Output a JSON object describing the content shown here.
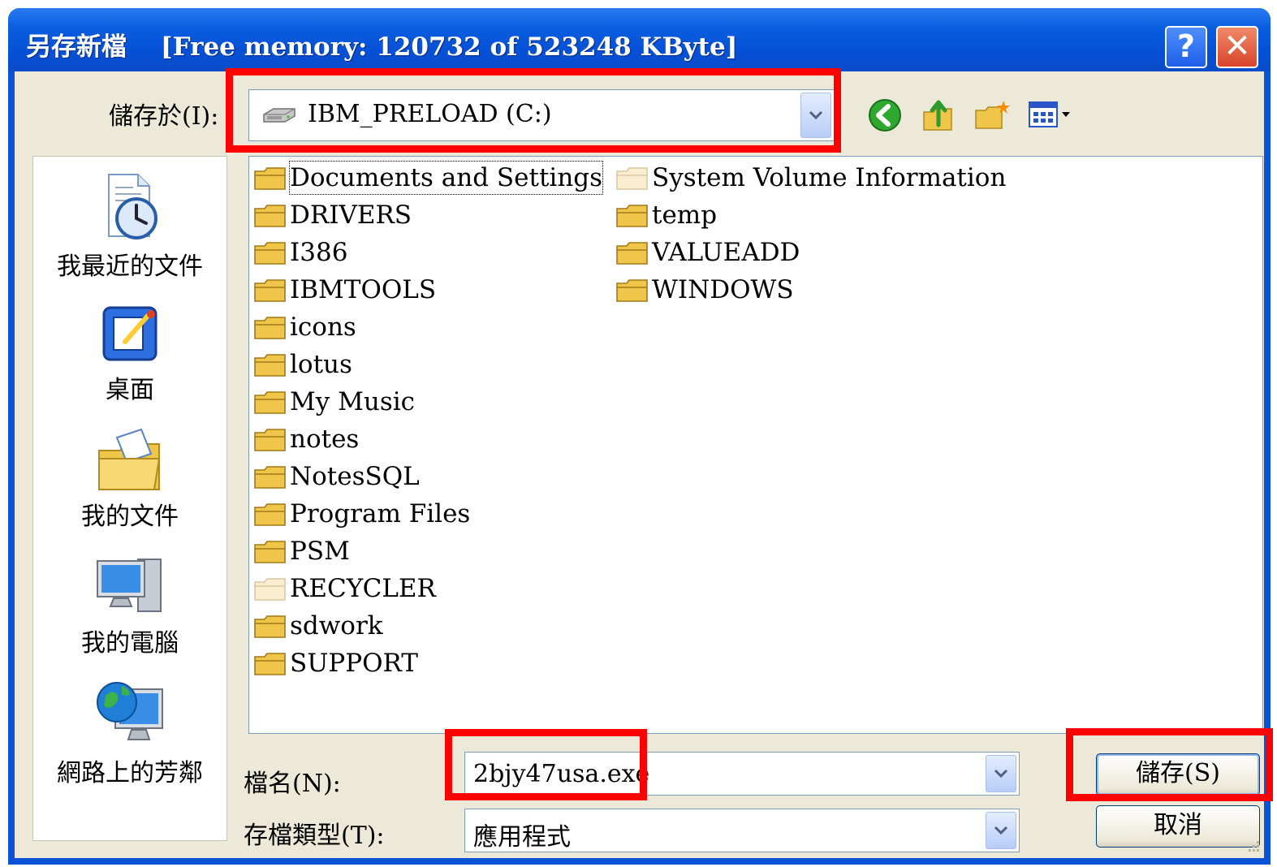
{
  "window": {
    "title": "另存新檔",
    "memory_info": "[Free memory: 120732 of 523248 KByte]",
    "help_label": "?",
    "close_label": "✕"
  },
  "save_in": {
    "label": "儲存於(I):",
    "value": "IBM_PRELOAD (C:)"
  },
  "toolbar": {
    "icons": [
      "back-icon",
      "up-folder-icon",
      "new-folder-icon",
      "view-menu-icon"
    ]
  },
  "places": [
    {
      "label": "我最近的文件",
      "icon": "recent-documents-icon"
    },
    {
      "label": "桌面",
      "icon": "desktop-icon"
    },
    {
      "label": "我的文件",
      "icon": "my-documents-icon"
    },
    {
      "label": "我的電腦",
      "icon": "my-computer-icon"
    },
    {
      "label": "網路上的芳鄰",
      "icon": "network-places-icon"
    }
  ],
  "files": [
    {
      "name": "Documents and Settings",
      "hidden": false
    },
    {
      "name": "DRIVERS",
      "hidden": false
    },
    {
      "name": "I386",
      "hidden": false
    },
    {
      "name": "IBMTOOLS",
      "hidden": false
    },
    {
      "name": "icons",
      "hidden": false
    },
    {
      "name": "lotus",
      "hidden": false
    },
    {
      "name": "My Music",
      "hidden": false
    },
    {
      "name": "notes",
      "hidden": false
    },
    {
      "name": "NotesSQL",
      "hidden": false
    },
    {
      "name": "Program Files",
      "hidden": false
    },
    {
      "name": "PSM",
      "hidden": false
    },
    {
      "name": "RECYCLER",
      "hidden": true
    },
    {
      "name": "sdwork",
      "hidden": false
    },
    {
      "name": "SUPPORT",
      "hidden": false
    },
    {
      "name": "System Volume Information",
      "hidden": true
    },
    {
      "name": "temp",
      "hidden": false
    },
    {
      "name": "VALUEADD",
      "hidden": false
    },
    {
      "name": "WINDOWS",
      "hidden": false
    }
  ],
  "filename": {
    "label": "檔名(N):",
    "value": "2bjy47usa.exe"
  },
  "filetype": {
    "label": "存檔類型(T):",
    "value": "應用程式"
  },
  "buttons": {
    "save": "儲存(S)",
    "cancel": "取消"
  },
  "colors": {
    "highlight": "#ff0000",
    "titlebar": "#0a53d8",
    "dialog_bg": "#ece9d8",
    "folder": "#f0c64a"
  }
}
